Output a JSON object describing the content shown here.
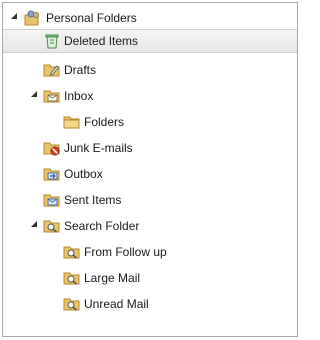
{
  "tree": {
    "root": {
      "label": "Personal Folders",
      "icon": "personal-folders-icon"
    },
    "items": [
      {
        "label": "Deleted Items",
        "icon": "recycle-bin-icon",
        "selected": true
      },
      {
        "label": "Drafts",
        "icon": "drafts-folder-icon"
      },
      {
        "label": "Inbox",
        "icon": "inbox-folder-icon",
        "expanded": true
      },
      {
        "label": "Folders",
        "icon": "folder-icon"
      },
      {
        "label": "Junk E-mails",
        "icon": "junk-mail-folder-icon"
      },
      {
        "label": "Outbox",
        "icon": "outbox-folder-icon"
      },
      {
        "label": "Sent Items",
        "icon": "sent-items-folder-icon"
      },
      {
        "label": "Search Folder",
        "icon": "search-folder-icon",
        "expanded": true
      },
      {
        "label": "From Follow up",
        "icon": "search-folder-icon"
      },
      {
        "label": "Large Mail",
        "icon": "search-folder-icon"
      },
      {
        "label": "Unread Mail",
        "icon": "search-folder-icon"
      }
    ]
  },
  "colors": {
    "folder": "#e8c46a",
    "folder_dark": "#b8892f",
    "selection": "#e8e8e8",
    "border": "#a9a9a9"
  }
}
